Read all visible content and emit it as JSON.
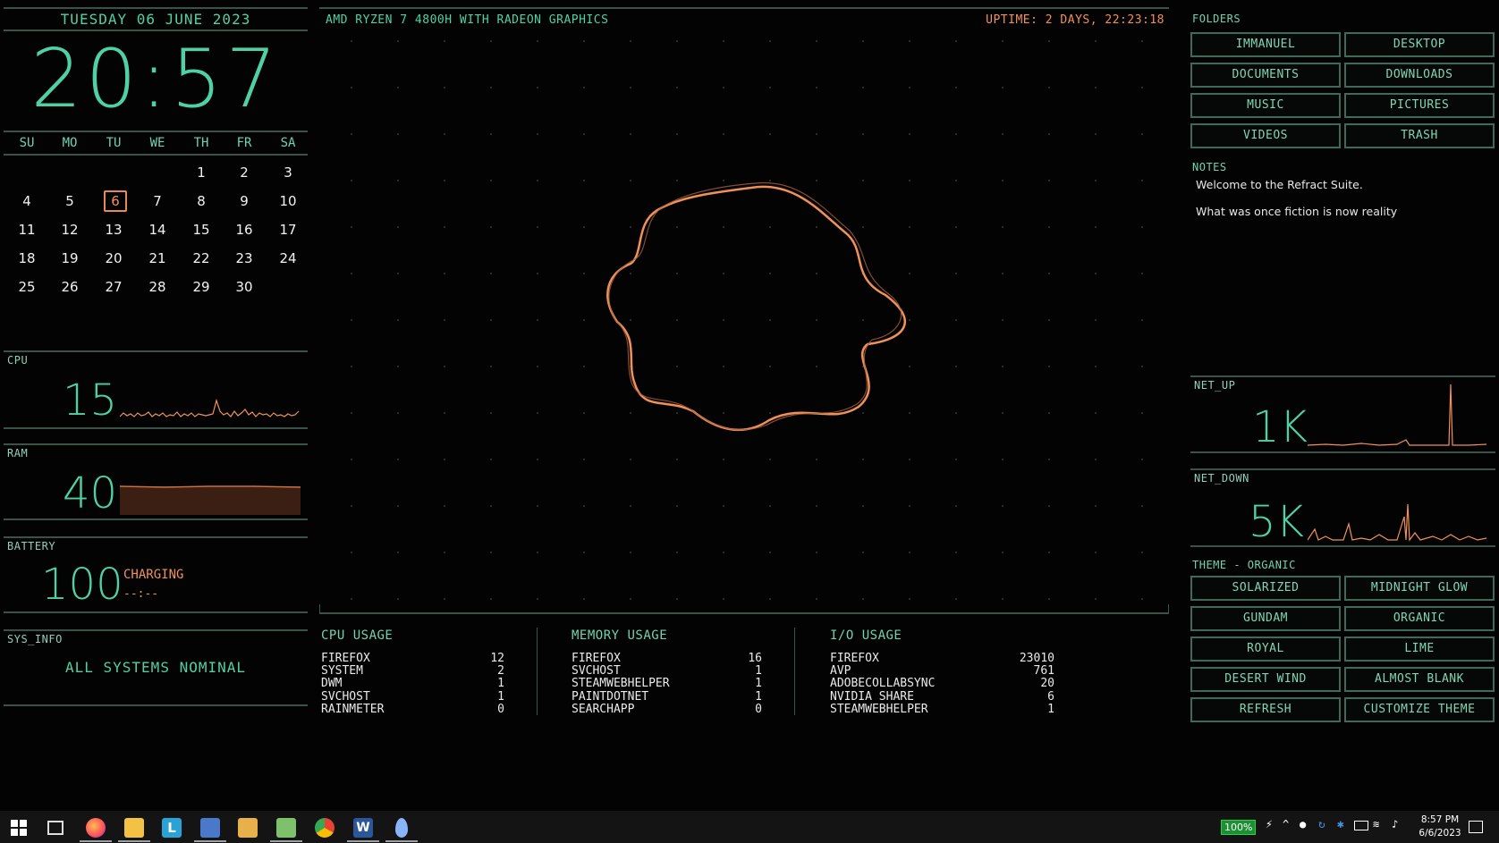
{
  "date_line": "TUESDAY 06 JUNE 2023",
  "clock": "20:57",
  "calendar": {
    "weekdays": [
      "SU",
      "MO",
      "TU",
      "WE",
      "TH",
      "FR",
      "SA"
    ],
    "weeks": [
      [
        "",
        "",
        "",
        "",
        "1",
        "2",
        "3"
      ],
      [
        "4",
        "5",
        "6",
        "7",
        "8",
        "9",
        "10"
      ],
      [
        "11",
        "12",
        "13",
        "14",
        "15",
        "16",
        "17"
      ],
      [
        "18",
        "19",
        "20",
        "21",
        "22",
        "23",
        "24"
      ],
      [
        "25",
        "26",
        "27",
        "28",
        "29",
        "30",
        ""
      ]
    ],
    "today": "6"
  },
  "cpu": {
    "label": "CPU",
    "value": "15"
  },
  "ram": {
    "label": "RAM",
    "value": "40"
  },
  "battery": {
    "label": "BATTERY",
    "value": "100",
    "status": "CHARGING",
    "time": "--:--"
  },
  "sys_info": {
    "label": "SYS_INFO",
    "status": "ALL SYSTEMS NOMINAL"
  },
  "header": {
    "cpu_name": "AMD RYZEN 7 4800H WITH RADEON GRAPHICS",
    "uptime": "UPTIME: 2 DAYS, 22:23:18"
  },
  "processes": {
    "cpu": {
      "title": "CPU USAGE",
      "rows": [
        [
          "FIREFOX",
          "12"
        ],
        [
          "SYSTEM",
          "2"
        ],
        [
          "DWM",
          "1"
        ],
        [
          "SVCHOST",
          "1"
        ],
        [
          "RAINMETER",
          "0"
        ]
      ]
    },
    "memory": {
      "title": "MEMORY USAGE",
      "rows": [
        [
          "FIREFOX",
          "16"
        ],
        [
          "SVCHOST",
          "1"
        ],
        [
          "STEAMWEBHELPER",
          "1"
        ],
        [
          "PAINTDOTNET",
          "1"
        ],
        [
          "SEARCHAPP",
          "0"
        ]
      ]
    },
    "io": {
      "title": "I/O USAGE",
      "rows": [
        [
          "FIREFOX",
          "23010"
        ],
        [
          "AVP",
          "761"
        ],
        [
          "ADOBECOLLABSYNC",
          "20"
        ],
        [
          "NVIDIA SHARE",
          "6"
        ],
        [
          "STEAMWEBHELPER",
          "1"
        ]
      ]
    }
  },
  "folders": {
    "label": "FOLDERS",
    "items": [
      "IMMANUEL",
      "DESKTOP",
      "DOCUMENTS",
      "DOWNLOADS",
      "MUSIC",
      "PICTURES",
      "VIDEOS",
      "TRASH"
    ]
  },
  "notes": {
    "label": "NOTES",
    "lines": [
      "Welcome to the Refract Suite.",
      "What was once fiction is now reality"
    ]
  },
  "net_up": {
    "label": "NET_UP",
    "value": "1K"
  },
  "net_down": {
    "label": "NET_DOWN",
    "value": "5K"
  },
  "themes": {
    "label": "THEME - ORGANIC",
    "items": [
      "SOLARIZED",
      "MIDNIGHT GLOW",
      "GUNDAM",
      "ORGANIC",
      "ROYAL",
      "LIME",
      "DESERT WIND",
      "ALMOST BLANK",
      "REFRESH",
      "CUSTOMIZE THEME"
    ]
  },
  "taskbar": {
    "battery_percent": "100%",
    "time": "8:57 PM",
    "date": "6/6/2023"
  },
  "colors": {
    "accent": "#4fd1a5",
    "orange": "#f0915a",
    "background": "#030303"
  }
}
